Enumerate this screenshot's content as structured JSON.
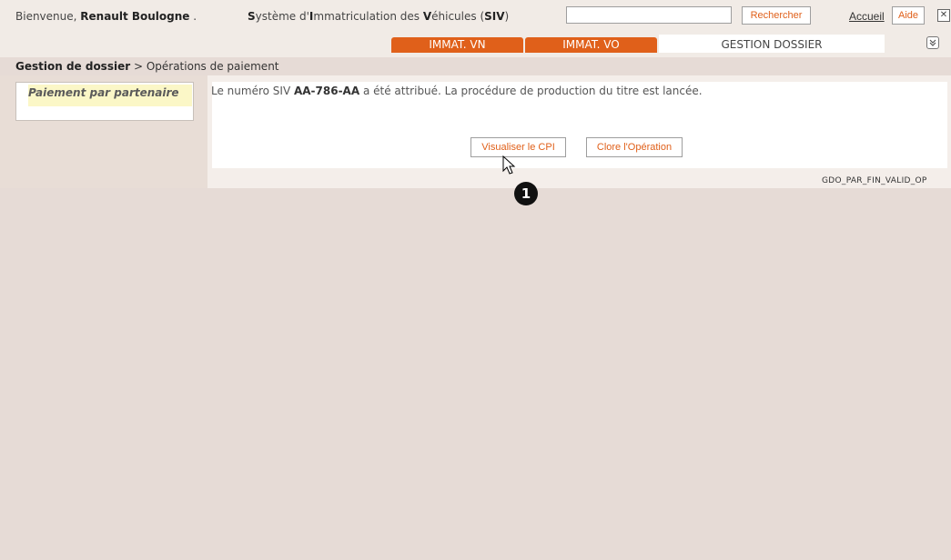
{
  "header": {
    "welcome_prefix": "Bienvenue, ",
    "user_name": "Renault Boulogne",
    "welcome_suffix": " .",
    "system_title_parts": [
      {
        "t": "S",
        "b": true
      },
      {
        "t": "ystème d'",
        "b": false
      },
      {
        "t": "I",
        "b": true
      },
      {
        "t": "mmatriculation des ",
        "b": false
      },
      {
        "t": "V",
        "b": true
      },
      {
        "t": "éhicules (",
        "b": false
      },
      {
        "t": "SIV",
        "b": true
      },
      {
        "t": ")",
        "b": false
      }
    ],
    "search_value": "",
    "search_button": "Rechercher",
    "accueil_link": "Accueil",
    "aide_button": "Aide"
  },
  "tabs": [
    {
      "label": "IMMAT. VN",
      "active": false
    },
    {
      "label": "IMMAT. VO",
      "active": false
    },
    {
      "label": "GESTION DOSSIER",
      "active": true
    }
  ],
  "breadcrumb": {
    "root": "Gestion de dossier",
    "separator": " > ",
    "current": "Opérations de paiement"
  },
  "sidebar": {
    "item_label": "Paiement par partenaire"
  },
  "main": {
    "message_prefix": "Le numéro SIV ",
    "plate_number": "AA-786-AA",
    "message_suffix": " a été attribué. La procédure de production du titre est lancée.",
    "view_cpi_button": "Visualiser le CPI",
    "close_operation_button": "Clore l'Opération",
    "screen_code": "GDO_PAR_FIN_VALID_OP"
  },
  "annotation": {
    "step_number": "1"
  },
  "colors": {
    "accent": "#e0601a",
    "background": "#e6dbd6",
    "highlight": "#fbf7c7"
  }
}
